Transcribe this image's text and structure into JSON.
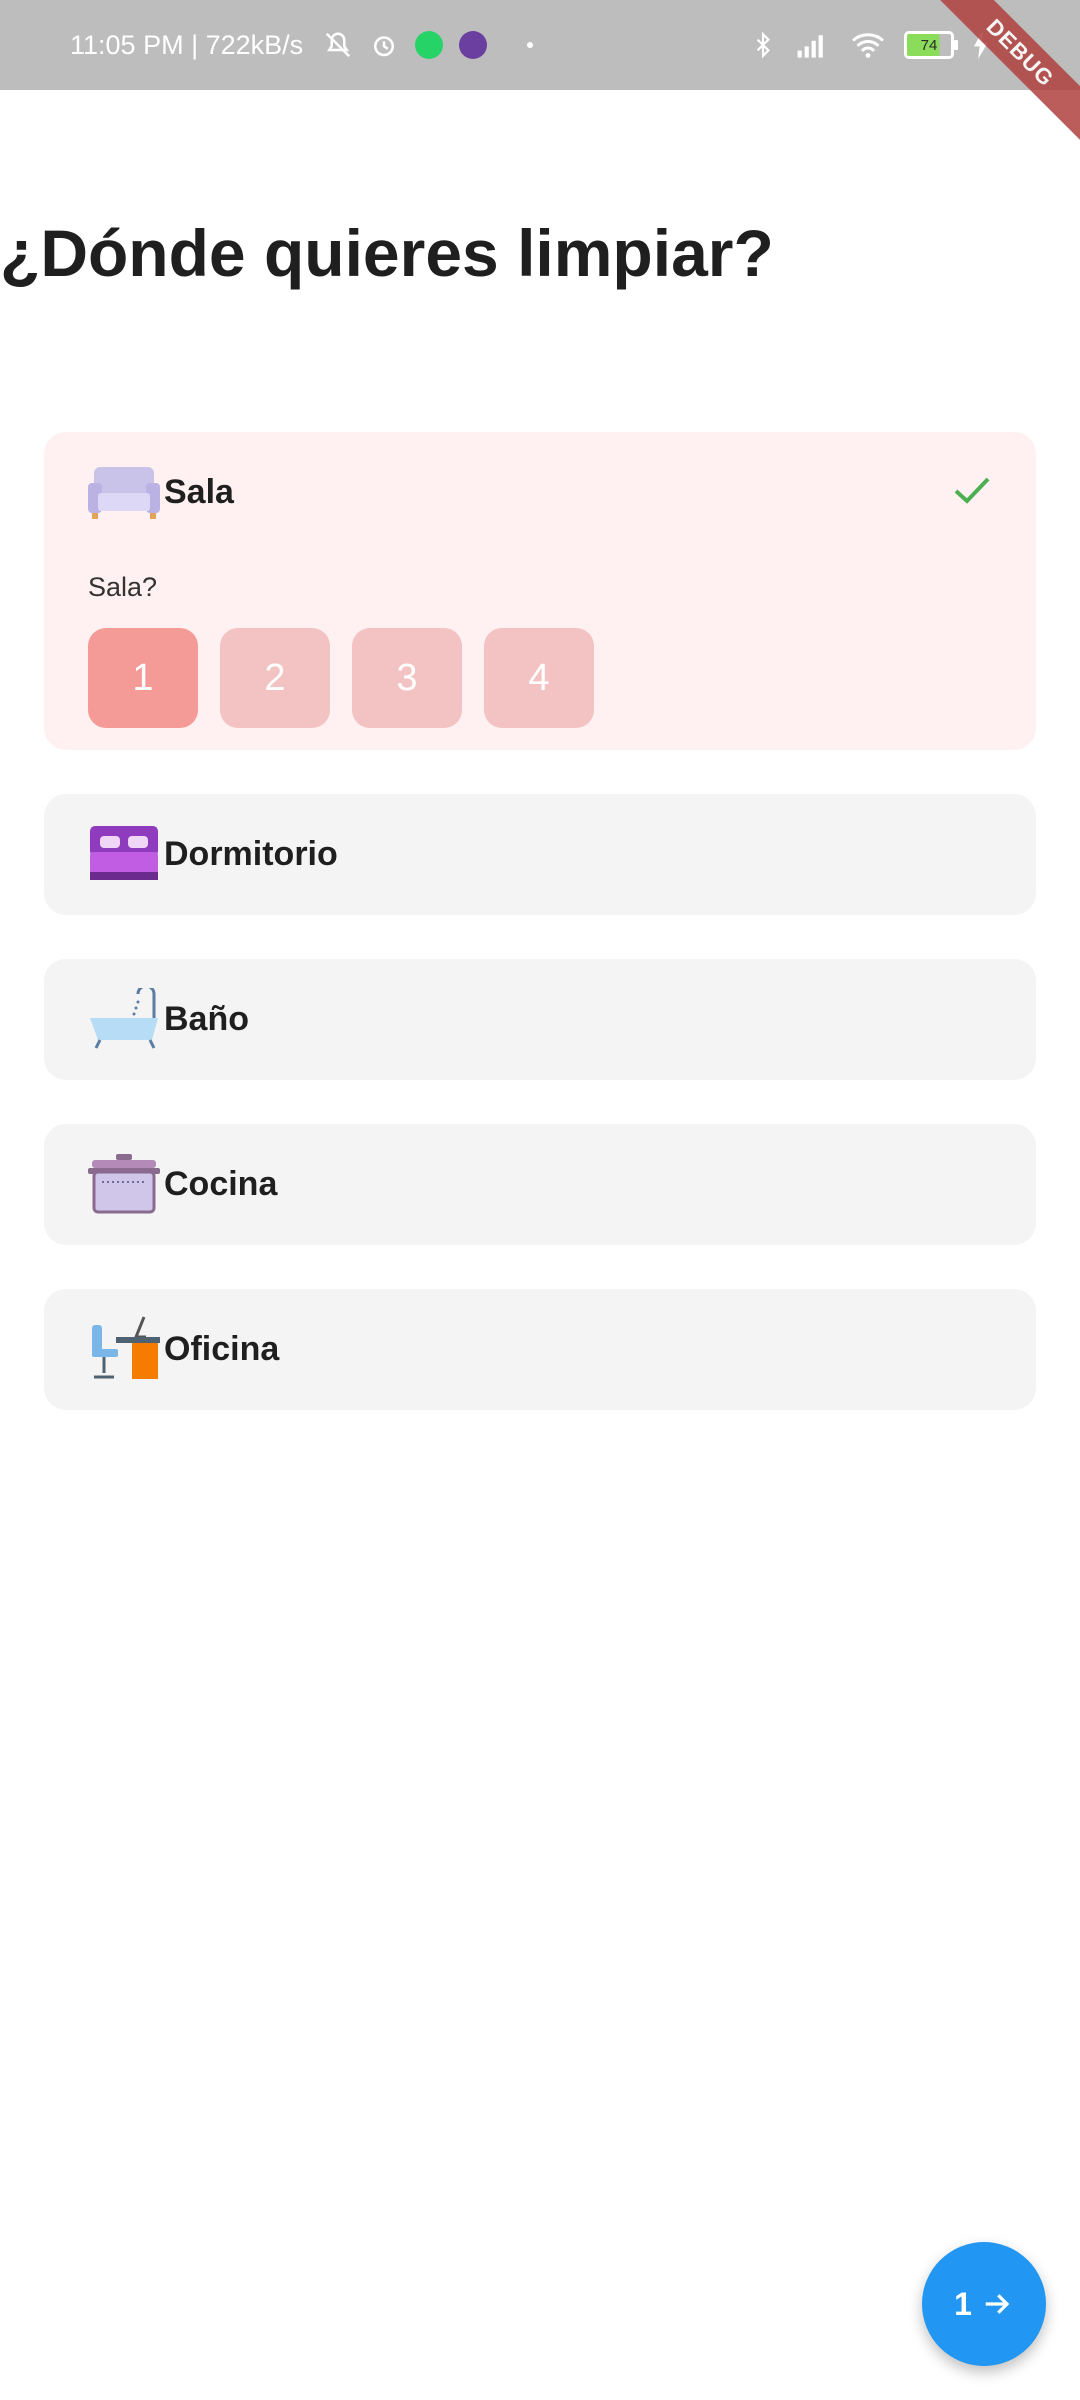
{
  "status_bar": {
    "time_speed": "11:05 PM | 722kB/s",
    "battery_level": "74",
    "debug_label": "DEBUG"
  },
  "page": {
    "title": "¿Dónde quieres limpiar?"
  },
  "rooms": [
    {
      "label": "Sala",
      "icon": "sofa-icon",
      "selected": true,
      "question": "Sala?",
      "quantities": [
        "1",
        "2",
        "3",
        "4"
      ],
      "selected_quantity": "1"
    },
    {
      "label": "Dormitorio",
      "icon": "bed-icon",
      "selected": false
    },
    {
      "label": "Baño",
      "icon": "bathtub-icon",
      "selected": false
    },
    {
      "label": "Cocina",
      "icon": "cooking-pot-icon",
      "selected": false
    },
    {
      "label": "Oficina",
      "icon": "office-desk-icon",
      "selected": false
    }
  ],
  "fab": {
    "count": "1",
    "icon": "arrow-right-icon"
  },
  "colors": {
    "accent_blue": "#2196f3",
    "selected_card_bg": "#fff1f2",
    "qty_active": "#f59b97",
    "qty_inactive": "#f3c2c2",
    "check_green": "#4caf50"
  }
}
